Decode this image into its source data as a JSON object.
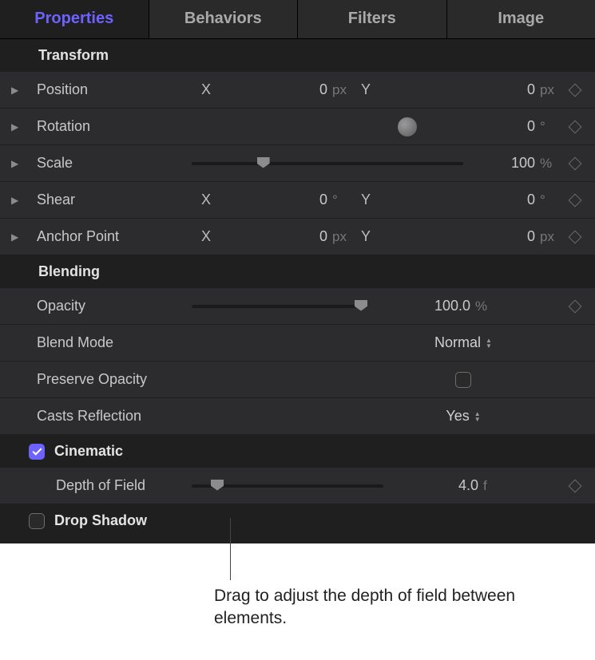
{
  "tabs": {
    "properties": "Properties",
    "behaviors": "Behaviors",
    "filters": "Filters",
    "image": "Image"
  },
  "sections": {
    "transform": "Transform",
    "blending": "Blending",
    "cinematic": "Cinematic",
    "drop_shadow": "Drop Shadow"
  },
  "transform": {
    "position": {
      "label": "Position",
      "x": "0",
      "xu": "px",
      "y": "0",
      "yu": "px",
      "axisX": "X",
      "axisY": "Y"
    },
    "rotation": {
      "label": "Rotation",
      "val": "0",
      "unit": "°"
    },
    "scale": {
      "label": "Scale",
      "val": "100",
      "unit": "%"
    },
    "shear": {
      "label": "Shear",
      "x": "0",
      "xu": "°",
      "y": "0",
      "yu": "°",
      "axisX": "X",
      "axisY": "Y"
    },
    "anchor": {
      "label": "Anchor Point",
      "x": "0",
      "xu": "px",
      "y": "0",
      "yu": "px",
      "axisX": "X",
      "axisY": "Y"
    }
  },
  "blending": {
    "opacity": {
      "label": "Opacity",
      "val": "100.0",
      "unit": "%"
    },
    "blend_mode": {
      "label": "Blend Mode",
      "val": "Normal"
    },
    "preserve": {
      "label": "Preserve Opacity"
    },
    "casts": {
      "label": "Casts Reflection",
      "val": "Yes"
    }
  },
  "cinematic": {
    "dof": {
      "label": "Depth of Field",
      "val": "4.0",
      "unit": "f"
    }
  },
  "callout": "Drag to adjust the depth of field between elements."
}
